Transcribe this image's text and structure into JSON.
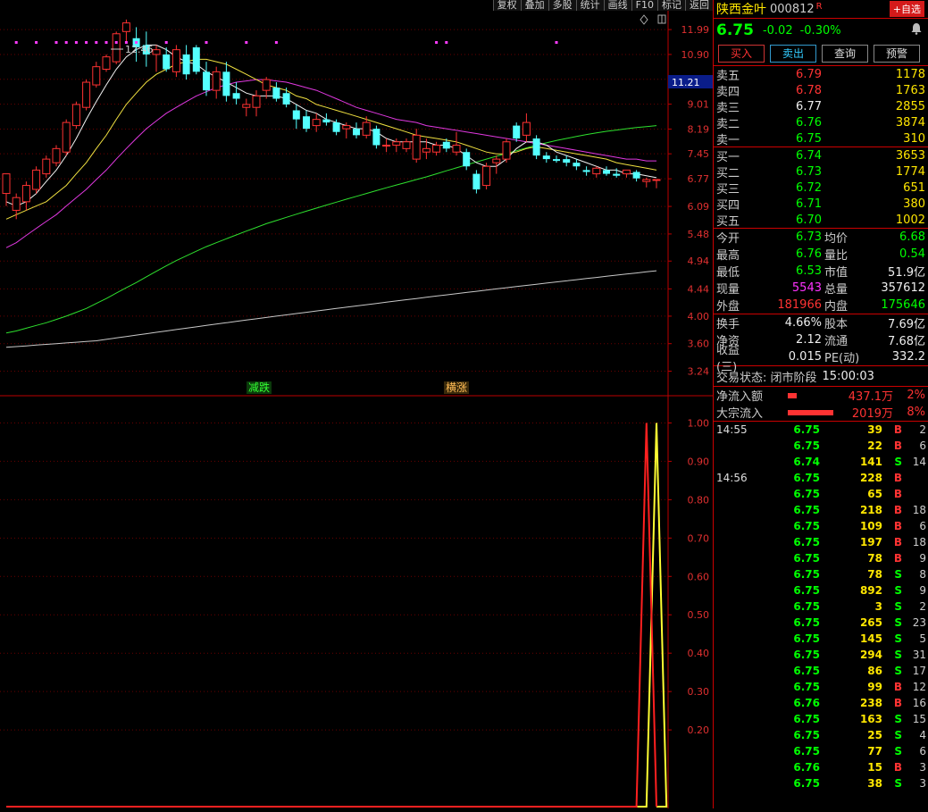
{
  "toolbar": {
    "items": [
      "复权",
      "叠加",
      "多股",
      "统计",
      "画线",
      "F10",
      "标记",
      "返回"
    ]
  },
  "chart": {
    "price_ticks": [
      "11.99",
      "10.90",
      "9.91",
      "9.01",
      "8.19",
      "7.45",
      "6.77",
      "6.09",
      "5.48",
      "4.94",
      "4.44",
      "4.00",
      "3.60",
      "3.24"
    ],
    "current_price_tag": "11.21",
    "high_marker": "12.46",
    "signal_fall": "减跌",
    "signal_rise": "横涨",
    "indicator_ticks": [
      "1.00",
      "0.90",
      "0.80",
      "0.70",
      "0.60",
      "0.50",
      "0.40",
      "0.30",
      "0.20"
    ]
  },
  "header": {
    "name": "陕西金叶",
    "code": "000812",
    "flag": "R",
    "add_label": "+自选"
  },
  "quote": {
    "price": "6.75",
    "change": "-0.02",
    "pct": "-0.30%"
  },
  "buttons": {
    "buy": "买入",
    "sell": "卖出",
    "query": "查询",
    "alert": "预警"
  },
  "sell_orders": [
    {
      "label": "卖五",
      "price": "6.79",
      "vol": "1178",
      "pc": "red"
    },
    {
      "label": "卖四",
      "price": "6.78",
      "vol": "1763",
      "pc": "red"
    },
    {
      "label": "卖三",
      "price": "6.77",
      "vol": "2855",
      "pc": "white"
    },
    {
      "label": "卖二",
      "price": "6.76",
      "vol": "3874",
      "pc": "green"
    },
    {
      "label": "卖一",
      "price": "6.75",
      "vol": "310",
      "pc": "green"
    }
  ],
  "buy_orders": [
    {
      "label": "买一",
      "price": "6.74",
      "vol": "3653",
      "pc": "green"
    },
    {
      "label": "买二",
      "price": "6.73",
      "vol": "1774",
      "pc": "green"
    },
    {
      "label": "买三",
      "price": "6.72",
      "vol": "651",
      "pc": "green"
    },
    {
      "label": "买四",
      "price": "6.71",
      "vol": "380",
      "pc": "green"
    },
    {
      "label": "买五",
      "price": "6.70",
      "vol": "1002",
      "pc": "green"
    }
  ],
  "stats1": [
    {
      "l1": "今开",
      "v1": "6.73",
      "c1": "green",
      "l2": "均价",
      "v2": "6.68",
      "c2": "green"
    },
    {
      "l1": "最高",
      "v1": "6.76",
      "c1": "green",
      "l2": "量比",
      "v2": "0.54",
      "c2": "green"
    },
    {
      "l1": "最低",
      "v1": "6.53",
      "c1": "green",
      "l2": "市值",
      "v2": "51.9亿",
      "c2": "white"
    },
    {
      "l1": "现量",
      "v1": "5543",
      "c1": "mag",
      "l2": "总量",
      "v2": "357612",
      "c2": "white"
    },
    {
      "l1": "外盘",
      "v1": "181966",
      "c1": "red",
      "l2": "内盘",
      "v2": "175646",
      "c2": "green"
    }
  ],
  "stats2": [
    {
      "l1": "换手",
      "v1": "4.66%",
      "c1": "white",
      "l2": "股本",
      "v2": "7.69亿",
      "c2": "white"
    },
    {
      "l1": "净资",
      "v1": "2.12",
      "c1": "white",
      "l2": "流通",
      "v2": "7.68亿",
      "c2": "white"
    },
    {
      "l1": "收益(三)",
      "v1": "0.015",
      "c1": "white",
      "l2": "PE(动)",
      "v2": "332.2",
      "c2": "white"
    }
  ],
  "status": {
    "label": "交易状态: 闭市阶段",
    "time": "15:00:03"
  },
  "flows": [
    {
      "label": "净流入额",
      "value": "437.1万",
      "pct": "2%",
      "bar": 0.15
    },
    {
      "label": "大宗流入",
      "value": "2019万",
      "pct": "8%",
      "bar": 0.8
    }
  ],
  "ticks": [
    {
      "t": "14:55",
      "p": "6.75",
      "v": "39",
      "f": "B",
      "n": "2",
      "vc": "yellow"
    },
    {
      "t": "",
      "p": "6.75",
      "v": "22",
      "f": "B",
      "n": "6",
      "vc": "yellow"
    },
    {
      "t": "",
      "p": "6.74",
      "v": "141",
      "f": "S",
      "n": "14",
      "vc": "yellow"
    },
    {
      "t": "14:56",
      "p": "6.75",
      "v": "228",
      "f": "B",
      "n": "",
      "vc": "yellow"
    },
    {
      "t": "",
      "p": "6.75",
      "v": "65",
      "f": "B",
      "n": "",
      "vc": "yellow"
    },
    {
      "t": "",
      "p": "6.75",
      "v": "218",
      "f": "B",
      "n": "18",
      "vc": "yellow"
    },
    {
      "t": "",
      "p": "6.75",
      "v": "109",
      "f": "B",
      "n": "6",
      "vc": "yellow"
    },
    {
      "t": "",
      "p": "6.75",
      "v": "197",
      "f": "B",
      "n": "18",
      "vc": "yellow"
    },
    {
      "t": "",
      "p": "6.75",
      "v": "78",
      "f": "B",
      "n": "9",
      "vc": "yellow"
    },
    {
      "t": "",
      "p": "6.75",
      "v": "78",
      "f": "S",
      "n": "8",
      "vc": "yellow"
    },
    {
      "t": "",
      "p": "6.75",
      "v": "892",
      "f": "S",
      "n": "9",
      "vc": "mag"
    },
    {
      "t": "",
      "p": "6.75",
      "v": "3",
      "f": "S",
      "n": "2",
      "vc": "yellow"
    },
    {
      "t": "",
      "p": "6.75",
      "v": "265",
      "f": "S",
      "n": "23",
      "vc": "yellow"
    },
    {
      "t": "",
      "p": "6.75",
      "v": "145",
      "f": "S",
      "n": "5",
      "vc": "yellow"
    },
    {
      "t": "",
      "p": "6.75",
      "v": "294",
      "f": "S",
      "n": "31",
      "vc": "yellow"
    },
    {
      "t": "",
      "p": "6.75",
      "v": "86",
      "f": "S",
      "n": "17",
      "vc": "yellow"
    },
    {
      "t": "",
      "p": "6.75",
      "v": "99",
      "f": "B",
      "n": "12",
      "vc": "yellow"
    },
    {
      "t": "",
      "p": "6.76",
      "v": "238",
      "f": "B",
      "n": "16",
      "vc": "yellow"
    },
    {
      "t": "",
      "p": "6.75",
      "v": "163",
      "f": "S",
      "n": "15",
      "vc": "yellow"
    },
    {
      "t": "",
      "p": "6.75",
      "v": "25",
      "f": "S",
      "n": "4",
      "vc": "yellow"
    },
    {
      "t": "",
      "p": "6.75",
      "v": "77",
      "f": "S",
      "n": "6",
      "vc": "yellow"
    },
    {
      "t": "",
      "p": "6.76",
      "v": "15",
      "f": "B",
      "n": "3",
      "vc": "yellow"
    },
    {
      "t": "",
      "p": "6.75",
      "v": "38",
      "f": "S",
      "n": "3",
      "vc": "yellow"
    }
  ],
  "chart_data": {
    "type": "candlestick",
    "y_scale": "log",
    "ylim": [
      3.0,
      12.8
    ],
    "bars": [
      {
        "o": 6.4,
        "h": 6.9,
        "l": 6.1,
        "c": 6.9
      },
      {
        "o": 6.0,
        "h": 6.4,
        "l": 5.8,
        "c": 6.3
      },
      {
        "o": 6.2,
        "h": 6.7,
        "l": 6.0,
        "c": 6.6
      },
      {
        "o": 6.5,
        "h": 7.1,
        "l": 6.4,
        "c": 7.0
      },
      {
        "o": 6.9,
        "h": 7.4,
        "l": 6.8,
        "c": 7.3
      },
      {
        "o": 7.2,
        "h": 7.7,
        "l": 7.1,
        "c": 7.6
      },
      {
        "o": 7.5,
        "h": 8.5,
        "l": 7.4,
        "c": 8.4
      },
      {
        "o": 8.3,
        "h": 9.1,
        "l": 8.2,
        "c": 9.0
      },
      {
        "o": 8.9,
        "h": 9.9,
        "l": 8.8,
        "c": 9.8
      },
      {
        "o": 9.7,
        "h": 10.6,
        "l": 9.6,
        "c": 10.4
      },
      {
        "o": 10.3,
        "h": 10.9,
        "l": 10.2,
        "c": 10.8
      },
      {
        "o": 10.6,
        "h": 11.9,
        "l": 10.5,
        "c": 11.8
      },
      {
        "o": 11.9,
        "h": 12.46,
        "l": 11.4,
        "c": 12.3
      },
      {
        "o": 11.6,
        "h": 12.1,
        "l": 10.6,
        "c": 11.2
      },
      {
        "o": 11.3,
        "h": 11.9,
        "l": 10.4,
        "c": 10.9
      },
      {
        "o": 10.9,
        "h": 11.3,
        "l": 10.2,
        "c": 11.1
      },
      {
        "o": 10.9,
        "h": 11.2,
        "l": 10.2,
        "c": 10.3
      },
      {
        "o": 10.2,
        "h": 11.3,
        "l": 10.0,
        "c": 11.1
      },
      {
        "o": 10.9,
        "h": 11.3,
        "l": 9.9,
        "c": 10.1
      },
      {
        "o": 11.2,
        "h": 11.3,
        "l": 10.1,
        "c": 10.2
      },
      {
        "o": 10.2,
        "h": 10.6,
        "l": 9.3,
        "c": 9.5
      },
      {
        "o": 9.5,
        "h": 10.4,
        "l": 9.2,
        "c": 10.2
      },
      {
        "o": 10.2,
        "h": 10.6,
        "l": 9.1,
        "c": 9.3
      },
      {
        "o": 9.4,
        "h": 9.8,
        "l": 9.0,
        "c": 9.2
      },
      {
        "o": 8.9,
        "h": 9.2,
        "l": 8.6,
        "c": 9.0
      },
      {
        "o": 8.9,
        "h": 9.5,
        "l": 8.6,
        "c": 9.3
      },
      {
        "o": 9.5,
        "h": 10.0,
        "l": 9.2,
        "c": 9.9
      },
      {
        "o": 9.6,
        "h": 9.8,
        "l": 9.1,
        "c": 9.2
      },
      {
        "o": 9.4,
        "h": 9.6,
        "l": 8.9,
        "c": 9.0
      },
      {
        "o": 8.8,
        "h": 9.0,
        "l": 8.2,
        "c": 8.5
      },
      {
        "o": 8.6,
        "h": 8.8,
        "l": 8.1,
        "c": 8.2
      },
      {
        "o": 8.3,
        "h": 8.7,
        "l": 8.1,
        "c": 8.5
      },
      {
        "o": 8.5,
        "h": 8.7,
        "l": 8.3,
        "c": 8.4
      },
      {
        "o": 8.4,
        "h": 8.5,
        "l": 8.0,
        "c": 8.1
      },
      {
        "o": 8.2,
        "h": 8.4,
        "l": 7.9,
        "c": 8.3
      },
      {
        "o": 8.2,
        "h": 8.4,
        "l": 7.9,
        "c": 8.0
      },
      {
        "o": 8.0,
        "h": 8.6,
        "l": 7.9,
        "c": 8.4
      },
      {
        "o": 8.2,
        "h": 8.3,
        "l": 7.6,
        "c": 7.7
      },
      {
        "o": 7.7,
        "h": 7.9,
        "l": 7.5,
        "c": 7.7
      },
      {
        "o": 7.7,
        "h": 7.9,
        "l": 7.5,
        "c": 7.8
      },
      {
        "o": 7.6,
        "h": 7.9,
        "l": 7.5,
        "c": 7.8
      },
      {
        "o": 7.3,
        "h": 8.2,
        "l": 7.2,
        "c": 8.0
      },
      {
        "o": 7.5,
        "h": 7.9,
        "l": 7.3,
        "c": 7.6
      },
      {
        "o": 7.5,
        "h": 7.8,
        "l": 7.4,
        "c": 7.7
      },
      {
        "o": 7.8,
        "h": 7.9,
        "l": 7.5,
        "c": 7.6
      },
      {
        "o": 7.5,
        "h": 8.1,
        "l": 7.4,
        "c": 7.7
      },
      {
        "o": 7.5,
        "h": 7.6,
        "l": 7.0,
        "c": 7.1
      },
      {
        "o": 6.9,
        "h": 7.0,
        "l": 6.4,
        "c": 6.5
      },
      {
        "o": 6.6,
        "h": 7.2,
        "l": 6.5,
        "c": 7.1
      },
      {
        "o": 7.2,
        "h": 7.4,
        "l": 6.9,
        "c": 7.3
      },
      {
        "o": 7.3,
        "h": 7.9,
        "l": 7.2,
        "c": 7.8
      },
      {
        "o": 8.3,
        "h": 8.4,
        "l": 7.8,
        "c": 7.9
      },
      {
        "o": 8.0,
        "h": 8.7,
        "l": 7.8,
        "c": 8.4
      },
      {
        "o": 7.9,
        "h": 8.0,
        "l": 7.3,
        "c": 7.4
      },
      {
        "o": 7.4,
        "h": 7.5,
        "l": 7.2,
        "c": 7.3
      },
      {
        "o": 7.3,
        "h": 7.4,
        "l": 7.2,
        "c": 7.25
      },
      {
        "o": 7.3,
        "h": 7.4,
        "l": 7.1,
        "c": 7.2
      },
      {
        "o": 7.2,
        "h": 7.3,
        "l": 7.0,
        "c": 7.1
      },
      {
        "o": 7.0,
        "h": 7.1,
        "l": 6.85,
        "c": 6.95
      },
      {
        "o": 6.9,
        "h": 7.1,
        "l": 6.8,
        "c": 7.05
      },
      {
        "o": 7.0,
        "h": 7.1,
        "l": 6.85,
        "c": 6.9
      },
      {
        "o": 6.9,
        "h": 7.05,
        "l": 6.8,
        "c": 6.85
      },
      {
        "o": 6.9,
        "h": 7.0,
        "l": 6.8,
        "c": 7.0
      },
      {
        "o": 6.95,
        "h": 7.0,
        "l": 6.7,
        "c": 6.78
      },
      {
        "o": 6.7,
        "h": 6.8,
        "l": 6.55,
        "c": 6.75
      },
      {
        "o": 6.73,
        "h": 6.76,
        "l": 6.53,
        "c": 6.75
      }
    ],
    "ma_white": [
      6.2,
      6.1,
      6.2,
      6.4,
      6.7,
      7.0,
      7.4,
      7.9,
      8.5,
      9.1,
      9.7,
      10.3,
      10.8,
      11.1,
      11.3,
      11.3,
      11.1,
      10.8,
      10.6,
      10.5,
      10.2,
      10.0,
      9.8,
      9.6,
      9.4,
      9.3,
      9.3,
      9.3,
      9.2,
      9.0,
      8.8,
      8.7,
      8.5,
      8.4,
      8.3,
      8.2,
      8.2,
      8.1,
      7.9,
      7.8,
      7.8,
      7.8,
      7.8,
      7.7,
      7.7,
      7.6,
      7.4,
      7.2,
      7.1,
      7.1,
      7.3,
      7.6,
      7.8,
      7.8,
      7.7,
      7.5,
      7.4,
      7.3,
      7.2,
      7.1,
      7.0,
      7.0,
      6.9,
      6.9,
      6.85,
      6.8
    ],
    "ma_yellow": [
      5.8,
      5.9,
      6.0,
      6.1,
      6.2,
      6.4,
      6.6,
      6.9,
      7.2,
      7.6,
      8.0,
      8.5,
      9.0,
      9.4,
      9.8,
      10.1,
      10.3,
      10.5,
      10.6,
      10.7,
      10.7,
      10.6,
      10.5,
      10.3,
      10.1,
      9.9,
      9.7,
      9.6,
      9.5,
      9.3,
      9.2,
      9.0,
      8.9,
      8.8,
      8.7,
      8.6,
      8.5,
      8.4,
      8.3,
      8.2,
      8.1,
      8.0,
      7.95,
      7.9,
      7.85,
      7.8,
      7.7,
      7.6,
      7.5,
      7.45,
      7.45,
      7.5,
      7.6,
      7.65,
      7.6,
      7.55,
      7.5,
      7.45,
      7.4,
      7.35,
      7.3,
      7.2,
      7.15,
      7.1,
      7.05,
      7.0
    ],
    "ma_magenta": [
      5.2,
      5.3,
      5.45,
      5.6,
      5.75,
      5.9,
      6.1,
      6.3,
      6.5,
      6.75,
      7.0,
      7.3,
      7.6,
      7.9,
      8.2,
      8.45,
      8.7,
      8.9,
      9.1,
      9.3,
      9.45,
      9.6,
      9.7,
      9.8,
      9.85,
      9.9,
      9.9,
      9.85,
      9.8,
      9.7,
      9.6,
      9.5,
      9.35,
      9.2,
      9.05,
      8.9,
      8.8,
      8.7,
      8.6,
      8.5,
      8.45,
      8.4,
      8.3,
      8.25,
      8.2,
      8.15,
      8.1,
      8.05,
      8.0,
      7.95,
      7.9,
      7.85,
      7.8,
      7.75,
      7.7,
      7.65,
      7.6,
      7.55,
      7.5,
      7.45,
      7.4,
      7.35,
      7.3,
      7.3,
      7.25,
      7.25
    ],
    "ma_green": [
      3.75,
      3.78,
      3.82,
      3.86,
      3.9,
      3.95,
      4.0,
      4.06,
      4.12,
      4.2,
      4.28,
      4.37,
      4.46,
      4.55,
      4.65,
      4.75,
      4.85,
      4.95,
      5.04,
      5.13,
      5.22,
      5.3,
      5.38,
      5.46,
      5.54,
      5.62,
      5.7,
      5.77,
      5.84,
      5.91,
      5.98,
      6.05,
      6.12,
      6.19,
      6.26,
      6.33,
      6.4,
      6.47,
      6.54,
      6.61,
      6.68,
      6.75,
      6.82,
      6.9,
      6.98,
      7.06,
      7.14,
      7.22,
      7.3,
      7.38,
      7.46,
      7.54,
      7.62,
      7.7,
      7.77,
      7.84,
      7.9,
      7.96,
      8.02,
      8.07,
      8.12,
      8.16,
      8.2,
      8.24,
      8.27,
      8.3
    ],
    "ma_gray": [
      3.55,
      3.56,
      3.57,
      3.58,
      3.59,
      3.6,
      3.61,
      3.62,
      3.63,
      3.64,
      3.66,
      3.68,
      3.7,
      3.72,
      3.74,
      3.76,
      3.78,
      3.8,
      3.82,
      3.84,
      3.86,
      3.88,
      3.9,
      3.92,
      3.94,
      3.96,
      3.98,
      4.0,
      4.02,
      4.04,
      4.06,
      4.08,
      4.1,
      4.12,
      4.14,
      4.16,
      4.18,
      4.2,
      4.22,
      4.24,
      4.26,
      4.28,
      4.3,
      4.32,
      4.34,
      4.36,
      4.38,
      4.4,
      4.42,
      4.44,
      4.46,
      4.48,
      4.5,
      4.52,
      4.54,
      4.56,
      4.58,
      4.6,
      4.62,
      4.64,
      4.66,
      4.68,
      4.7,
      4.72,
      4.74,
      4.76
    ],
    "dot_bars": [
      1,
      3,
      5,
      6,
      7,
      8,
      9,
      10,
      11,
      12,
      13,
      16,
      20,
      24,
      27,
      43,
      44,
      55
    ],
    "indicator": {
      "ylim": [
        0,
        1.05
      ],
      "red": [
        {
          "bar": 63,
          "value": 0
        },
        {
          "bar": 64,
          "value": 1.0
        },
        {
          "bar": 65,
          "value": 0
        }
      ],
      "yellow": [
        {
          "bar": 64,
          "value": 0
        },
        {
          "bar": 65,
          "value": 1.0
        },
        {
          "bar": 66,
          "value": 0
        }
      ]
    }
  }
}
